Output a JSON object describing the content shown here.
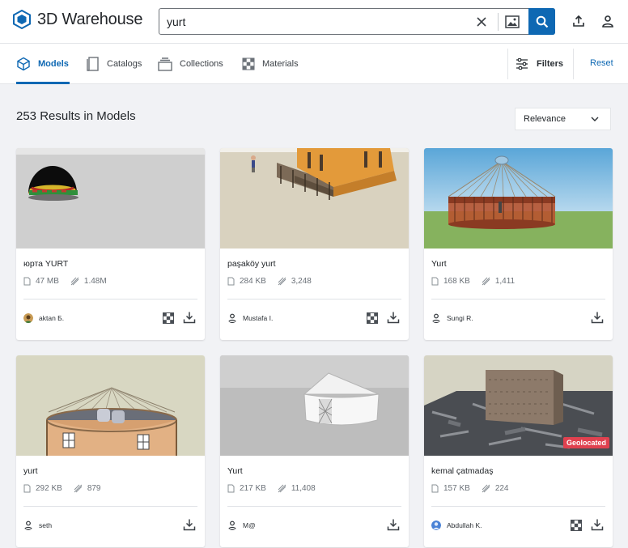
{
  "app": {
    "title": "3D Warehouse"
  },
  "search": {
    "value": "yurt",
    "placeholder": ""
  },
  "tabs": [
    {
      "label": "Models",
      "icon": "cube-icon",
      "active": true
    },
    {
      "label": "Catalogs",
      "icon": "catalog-icon",
      "active": false
    },
    {
      "label": "Collections",
      "icon": "collections-icon",
      "active": false
    },
    {
      "label": "Materials",
      "icon": "materials-icon",
      "active": false
    }
  ],
  "toolbar": {
    "filters_label": "Filters",
    "reset_label": "Reset"
  },
  "results": {
    "heading": "253 Results in Models",
    "sort_value": "Relevance"
  },
  "colors": {
    "accent": "#0e68b3",
    "geolocated_badge": "#e0414f"
  },
  "cards": [
    {
      "title": "юрта YURT",
      "size": "47 MB",
      "views": "1.48M",
      "author": "aktan Б.",
      "has_materials": true,
      "geolocated": ""
    },
    {
      "title": "paşaköy yurt",
      "size": "284 KB",
      "views": "3,248",
      "author": "Mustafa I.",
      "has_materials": true,
      "geolocated": ""
    },
    {
      "title": "Yurt",
      "size": "168 KB",
      "views": "1,411",
      "author": "Sungi R.",
      "has_materials": false,
      "geolocated": ""
    },
    {
      "title": "yurt",
      "size": "292 KB",
      "views": "879",
      "author": "seth",
      "has_materials": false,
      "geolocated": ""
    },
    {
      "title": "Yurt",
      "size": "217 KB",
      "views": "11,408",
      "author": "M@",
      "has_materials": false,
      "geolocated": ""
    },
    {
      "title": "kemal çatmadaş",
      "size": "157 KB",
      "views": "224",
      "author": "Abdullah K.",
      "has_materials": true,
      "geolocated": "Geolocated"
    }
  ]
}
